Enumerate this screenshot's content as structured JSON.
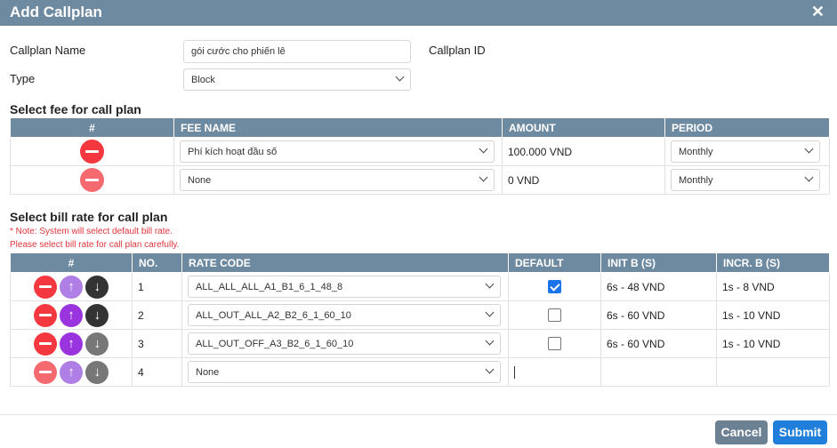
{
  "dialog": {
    "title": "Add Callplan"
  },
  "form": {
    "name_label": "Callplan Name",
    "name_value": "gói cước cho phiến lê",
    "id_label": "Callplan ID",
    "type_label": "Type",
    "type_value": "Block"
  },
  "fee_section": {
    "title": "Select fee for call plan",
    "headers": [
      "#",
      "FEE NAME",
      "AMOUNT",
      "PERIOD"
    ],
    "rows": [
      {
        "fee_name": "Phí kích hoạt đầu số",
        "amount": "100.000 VND",
        "period": "Monthly"
      },
      {
        "fee_name": "None",
        "amount": "0 VND",
        "period": "Monthly"
      }
    ]
  },
  "bill_section": {
    "title": "Select bill rate for call plan",
    "note1": "* Note: System will select default bill rate.",
    "note2": "Please select bill rate for call plan carefully.",
    "headers": [
      "#",
      "NO.",
      "RATE CODE",
      "DEFAULT",
      "INIT B (S)",
      "INCR. B (S)"
    ],
    "rows": [
      {
        "no": "1",
        "rate_code": "ALL_ALL_ALL_A1_B1_6_1_48_8",
        "default": true,
        "init": "6s - 48 VND",
        "incr": "1s - 8 VND"
      },
      {
        "no": "2",
        "rate_code": "ALL_OUT_ALL_A2_B2_6_1_60_10",
        "default": false,
        "init": "6s - 60 VND",
        "incr": "1s - 10 VND"
      },
      {
        "no": "3",
        "rate_code": "ALL_OUT_OFF_A3_B2_6_1_60_10",
        "default": false,
        "init": "6s - 60 VND",
        "incr": "1s - 10 VND"
      },
      {
        "no": "4",
        "rate_code": "None",
        "default": null,
        "init": "",
        "incr": ""
      }
    ]
  },
  "footer": {
    "cancel_label": "Cancel",
    "submit_label": "Submit"
  },
  "icons": {
    "close": "close-icon",
    "remove": "minus-circle-icon",
    "up": "arrow-up-icon",
    "down": "arrow-down-icon",
    "dropdown": "chevron-down-icon"
  },
  "colors": {
    "header": "#6e8aa0",
    "remove": "#f43840",
    "up": "#9a34de",
    "down": "#333333",
    "submit": "#1f7fdb",
    "cancel": "#6d8194",
    "note": "#e0353b",
    "checkbox": "#1a73e8"
  }
}
